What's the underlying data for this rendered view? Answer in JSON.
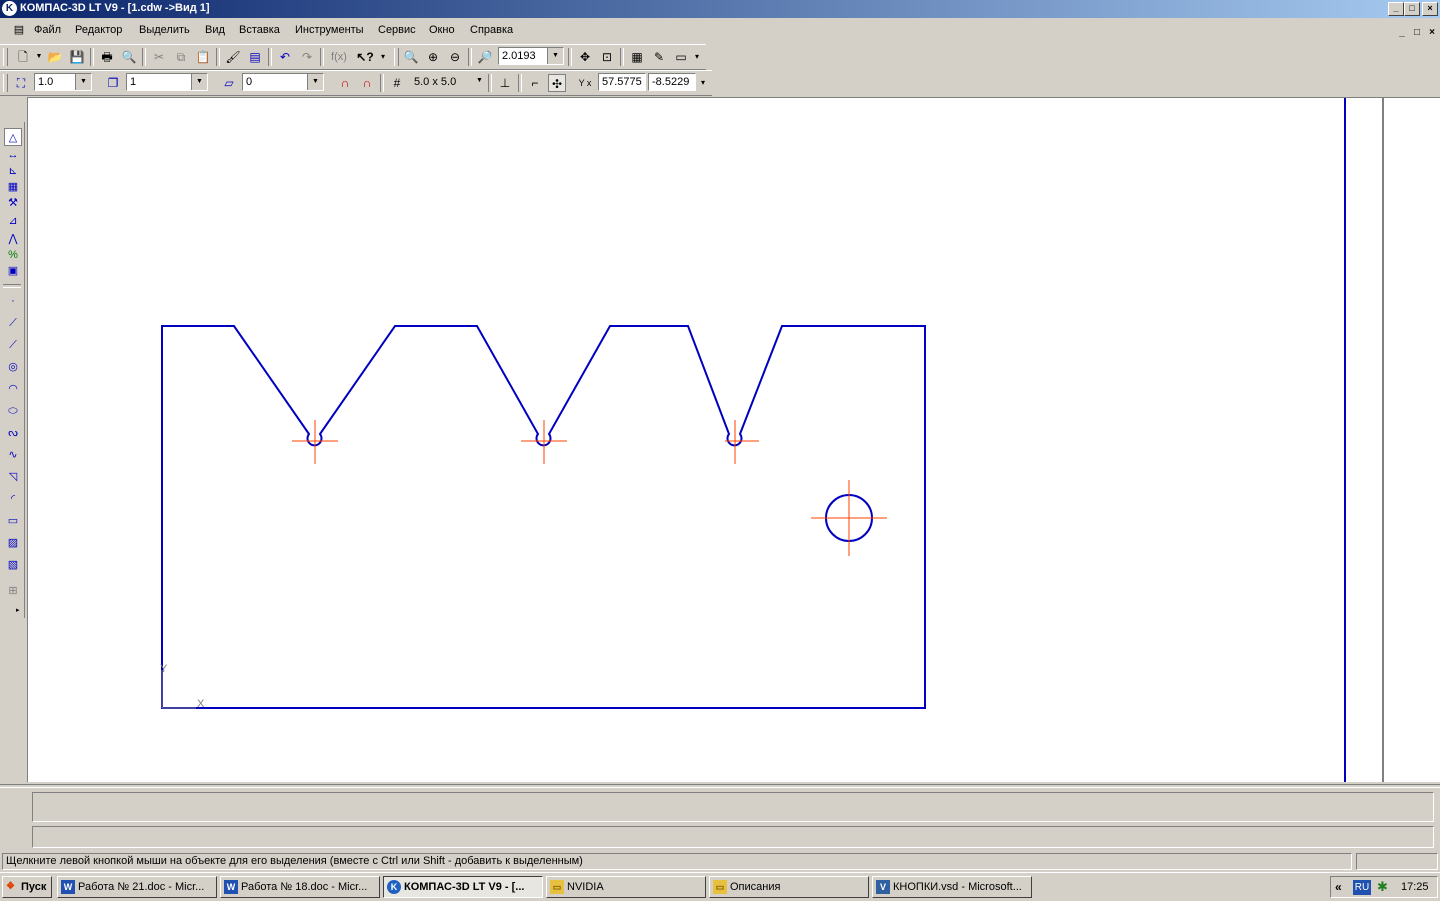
{
  "window": {
    "title": "КОМПАС-3D LT V9 - [1.cdw ->Вид 1]",
    "logo": "K",
    "controls": [
      "_",
      "□",
      "×"
    ],
    "mdi_controls": [
      "_",
      "□",
      "×"
    ]
  },
  "menu": [
    "Файл",
    "Редактор",
    "Выделить",
    "Вид",
    "Вставка",
    "Инструменты",
    "Сервис",
    "Окно",
    "Справка"
  ],
  "toolbar_top": {
    "fx_label": "f(x)",
    "zoom_value": "2.0193"
  },
  "toolbar_second": {
    "step_value": "1.0",
    "layer_value": "1",
    "style_value": "0",
    "grid_label": "5.0 x 5.0",
    "coord_x": "57.5775",
    "coord_y": "-8.5229"
  },
  "drawing": {
    "axis_y_label": "Y",
    "axis_x_label": "X",
    "line_color": "#0000c0",
    "center_color": "#ff4000"
  },
  "status": {
    "hint": "Щелкните левой кнопкой мыши на объекте для его выделения (вместе с Ctrl или Shift - добавить к выделенным)"
  },
  "taskbar": {
    "start_label": "Пуск",
    "buttons": [
      {
        "label": "Работа № 21.doc - Micr...",
        "icon": "word-icon"
      },
      {
        "label": "Работа № 18.doc - Micr...",
        "icon": "word-icon"
      },
      {
        "label": "КОМПАС-3D LT V9 - [...",
        "icon": "kompas-icon",
        "active": true
      },
      {
        "label": "NVIDIA",
        "icon": "folder-icon"
      },
      {
        "label": "Описания",
        "icon": "folder-icon"
      },
      {
        "label": "КНОПКИ.vsd - Microsoft...",
        "icon": "visio-icon"
      }
    ],
    "tray_chevron": "«",
    "lang": "RU",
    "clock": "17:25"
  }
}
